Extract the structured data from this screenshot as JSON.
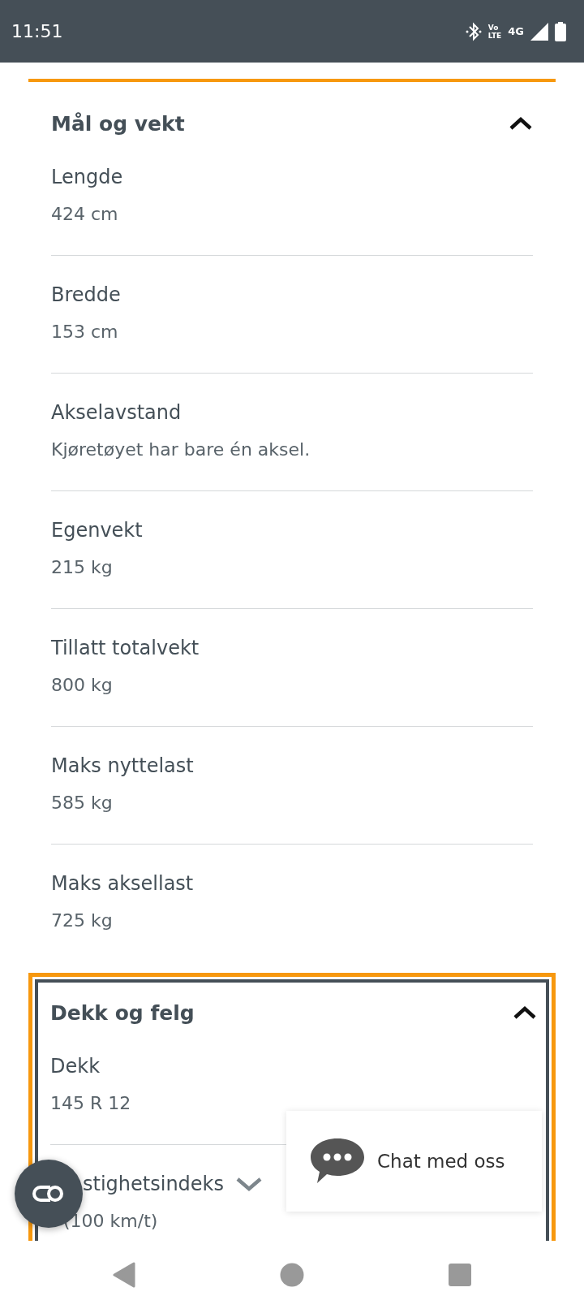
{
  "status_bar": {
    "time": "11:51",
    "volte": [
      "Vo",
      "LTE"
    ],
    "network": "4G"
  },
  "sections": [
    {
      "title": "Mål og vekt",
      "expanded": true,
      "focused": false,
      "rows": [
        {
          "label": "Lengde",
          "value": "424 cm"
        },
        {
          "label": "Bredde",
          "value": "153 cm"
        },
        {
          "label": "Akselavstand",
          "value": "Kjøretøyet har bare én aksel."
        },
        {
          "label": "Egenvekt",
          "value": "215 kg"
        },
        {
          "label": "Tillatt totalvekt",
          "value": "800 kg"
        },
        {
          "label": "Maks nyttelast",
          "value": "585 kg"
        },
        {
          "label": "Maks aksellast",
          "value": "725 kg"
        }
      ]
    },
    {
      "title": "Dekk og felg",
      "expanded": true,
      "focused": true,
      "rows": [
        {
          "label": "Dekk",
          "value": "145 R 12"
        },
        {
          "label": "stighetsindeks",
          "value": "(100 km/t)",
          "info": {
            "expanded": false
          }
        }
      ]
    }
  ],
  "chat": {
    "label": "Chat med oss"
  }
}
